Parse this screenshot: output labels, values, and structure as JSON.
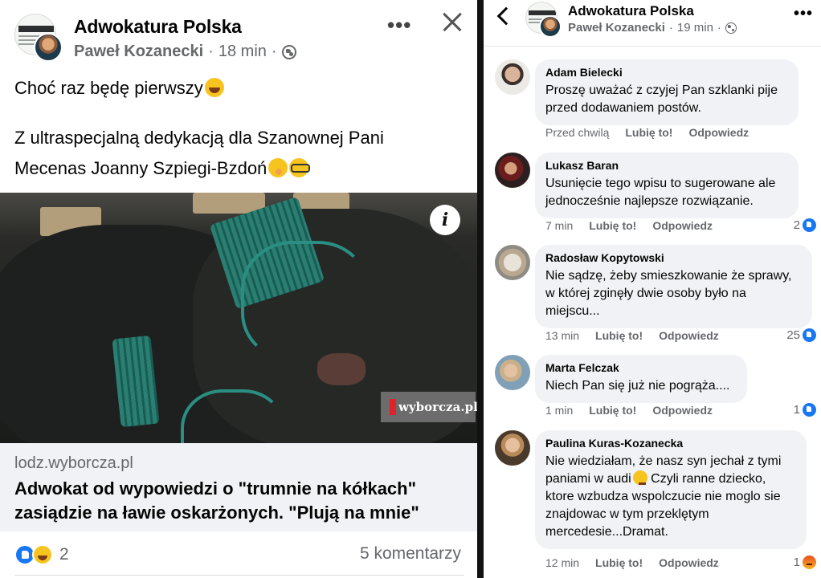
{
  "left": {
    "page_name": "Adwokatura Polska",
    "author": "Paweł Kozanecki",
    "time": "18 min",
    "dot": "·",
    "more": "•••",
    "text_line1": "Choć raz będę pierwszy",
    "text_line2": "Z ultraspecjalną dedykacją dla Szanownej Pani",
    "text_line3": "Mecenas Joanny Szpiegi-Bzdoń",
    "image_badge": "wyborcza.pl",
    "info": "i",
    "link_domain": "lodz.wyborcza.pl",
    "link_title": "Adwokat od wypowiedzi o \"trumnie na kółkach\" zasiądzie na ławie oskarżonych. \"Plują na mnie\"",
    "reaction_count": "2",
    "comment_count": "5 komentarzy"
  },
  "right": {
    "page_name": "Adwokatura Polska",
    "author": "Paweł Kozanecki",
    "time": "19 min",
    "dot": "·",
    "more": "•••",
    "comments": [
      {
        "name": "Adam Bielecki",
        "text": "Proszę uważać z czyjej Pan szklanki pije przed dodawaniem postów.",
        "time": "Przed chwilą",
        "like": "Lubię to!",
        "reply": "Odpowiedz",
        "reactions": ""
      },
      {
        "name": "Lukasz Baran",
        "text": "Usunięcie tego wpisu to sugerowane ale jednocześnie najlepsze rozwiązanie.",
        "time": "7 min",
        "like": "Lubię to!",
        "reply": "Odpowiedz",
        "reactions": "2"
      },
      {
        "name": "Radosław Kopytowski",
        "text": "Nie sądzę, żeby smieszkowanie że sprawy, w której zginęły dwie osoby było na miejscu...",
        "time": "13 min",
        "like": "Lubię to!",
        "reply": "Odpowiedz",
        "reactions": "25"
      },
      {
        "name": "Marta Felczak",
        "text": "Niech Pan się już nie pogrąża....",
        "time": "1 min",
        "like": "Lubię to!",
        "reply": "Odpowiedz",
        "reactions": "1"
      },
      {
        "name": "Paulina Kuras-Kozanecka",
        "text_part1": "Nie wiedziałam, że nasz syn jechał z tymi paniami w audi",
        "text_part2": " Czyli ranne dziecko, ktore wzbudza wspolczucie nie moglo sie znajdowac w tym przeklętym mercedesie...Dramat.",
        "time": "12 min",
        "like": "Lubię to!",
        "reply": "Odpowiedz",
        "reactions": "1"
      }
    ]
  },
  "colors": {
    "facebook_blue": "#1877f2",
    "bubble_bg": "#f0f2f5",
    "meta_gray": "#65676b",
    "robe_green": "#2a8f82"
  },
  "icons": [
    "globe-icon",
    "close-icon",
    "more-icon",
    "back-icon",
    "info-icon",
    "like-icon",
    "haha-icon",
    "angry-icon"
  ]
}
